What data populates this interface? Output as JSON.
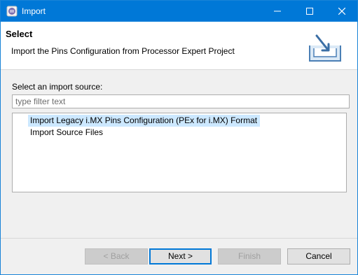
{
  "window": {
    "title": "Import"
  },
  "banner": {
    "heading": "Select",
    "description": "Import the Pins Configuration from Processor Expert Project"
  },
  "source": {
    "label": "Select an import source:",
    "filter_placeholder": "type filter text",
    "items": [
      {
        "label": "Import Legacy i.MX Pins Configuration (PEx for i.MX) Format",
        "selected": true
      },
      {
        "label": "Import Source Files",
        "selected": false
      }
    ]
  },
  "buttons": {
    "back": "< Back",
    "next": "Next >",
    "finish": "Finish",
    "cancel": "Cancel"
  },
  "colors": {
    "titlebar": "#0078d7",
    "selection": "#cce8ff"
  }
}
